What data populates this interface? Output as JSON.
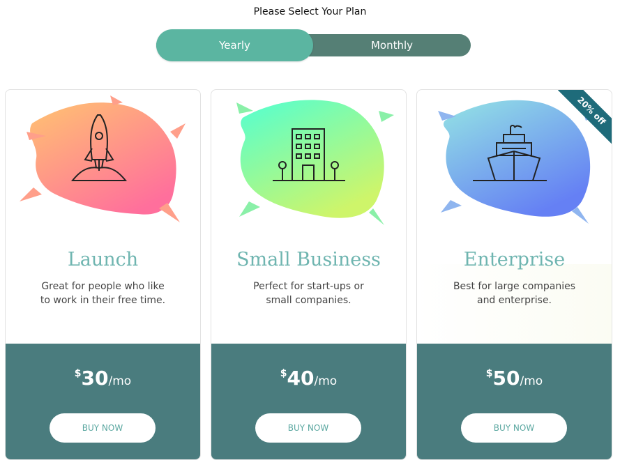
{
  "header": {
    "title": "Please Select Your Plan"
  },
  "billing_toggle": {
    "yearly_label": "Yearly",
    "monthly_label": "Monthly",
    "selected": "Yearly"
  },
  "plans": [
    {
      "name": "Launch",
      "description_line1": "Great for people who like",
      "description_line2": "to work in their free time.",
      "currency": "$",
      "amount": "30",
      "period": "/mo",
      "button_label": "BUY NOW",
      "icon": "rocket-icon",
      "colors": [
        "#ffc371",
        "#ff7a9a"
      ]
    },
    {
      "name": "Small Business",
      "description_line1": "Perfect for start-ups or",
      "description_line2": "small companies.",
      "currency": "$",
      "amount": "40",
      "period": "/mo",
      "button_label": "BUY NOW",
      "icon": "building-icon",
      "colors": [
        "#5affd0",
        "#c9f56f"
      ]
    },
    {
      "name": "Enterprise",
      "description_line1": "Best for large companies",
      "description_line2": "and enterprise.",
      "currency": "$",
      "amount": "50",
      "period": "/mo",
      "button_label": "BUY NOW",
      "icon": "ship-icon",
      "colors": [
        "#8fdce6",
        "#6a86f2"
      ],
      "badge": "20% off"
    }
  ],
  "theme": {
    "accent": "#5bb5a1",
    "toggle_dark": "#557f75",
    "footer": "#4a7c7e",
    "title_color": "#6fb5b0"
  }
}
